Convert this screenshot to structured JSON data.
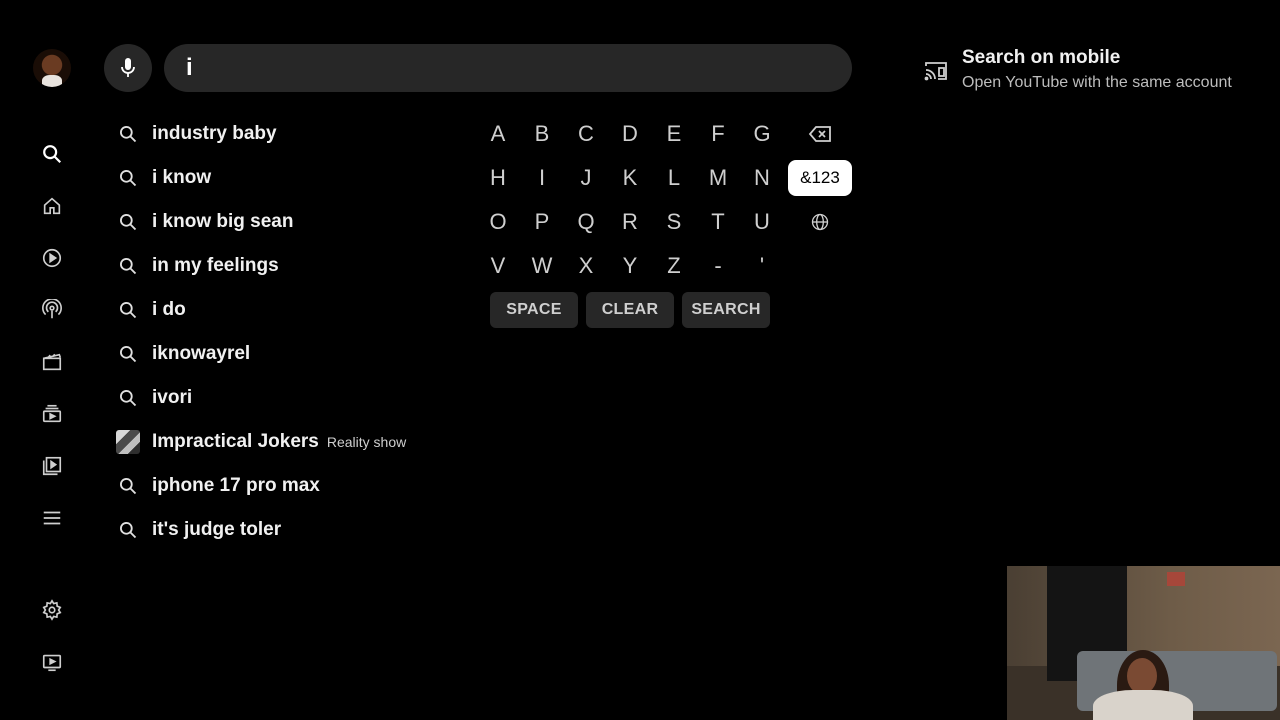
{
  "search": {
    "query": "i"
  },
  "suggestions": [
    {
      "text": "industry baby",
      "icon": "search-icon"
    },
    {
      "text": "i know",
      "icon": "search-icon"
    },
    {
      "text": "i know big sean",
      "icon": "search-icon"
    },
    {
      "text": "in my feelings",
      "icon": "search-icon"
    },
    {
      "text": "i do",
      "icon": "search-icon"
    },
    {
      "text": "iknowayrel",
      "icon": "search-icon"
    },
    {
      "text": "ivori",
      "icon": "search-icon"
    },
    {
      "text": "Impractical Jokers",
      "subtitle": "Reality show",
      "icon": "show-thumbnail"
    },
    {
      "text": "iphone 17 pro max",
      "icon": "search-icon"
    },
    {
      "text": "it's judge toler",
      "icon": "search-icon"
    }
  ],
  "keyboard": {
    "rows": [
      [
        "A",
        "B",
        "C",
        "D",
        "E",
        "F",
        "G"
      ],
      [
        "H",
        "I",
        "J",
        "K",
        "L",
        "M",
        "N"
      ],
      [
        "O",
        "P",
        "Q",
        "R",
        "S",
        "T",
        "U"
      ],
      [
        "V",
        "W",
        "X",
        "Y",
        "Z",
        "-",
        "'"
      ]
    ],
    "symbols_label": "&123",
    "space_label": "SPACE",
    "clear_label": "CLEAR",
    "search_label": "SEARCH"
  },
  "mobile_promo": {
    "title": "Search on mobile",
    "subtitle": "Open YouTube with the same account"
  },
  "sidebar": {
    "items": [
      "search-icon",
      "home-icon",
      "shorts-icon",
      "podcasts-icon",
      "movies-icon",
      "subscriptions-icon",
      "library-icon",
      "menu-icon",
      "settings-icon",
      "tv-icon"
    ]
  },
  "colors": {
    "background": "#000000",
    "surface": "#272727",
    "text": "#f1f1f1",
    "muted": "#cfcfcf",
    "focus": "#ffffff"
  }
}
